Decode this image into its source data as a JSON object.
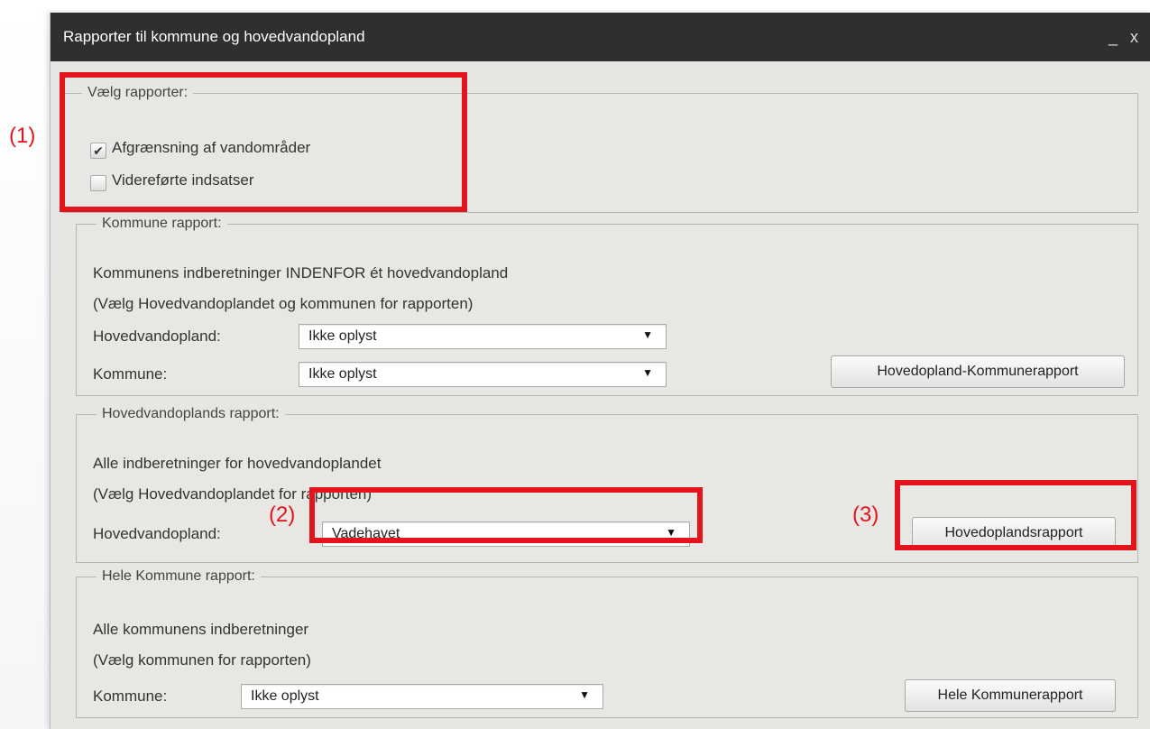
{
  "window": {
    "title": "Rapporter til kommune og hovedvandopland",
    "minimize_label": "_",
    "close_label": "x"
  },
  "top_partial_text": "Rapporter til kommune og hovedvandopland — øverst afskåret",
  "select_reports": {
    "legend": "Vælg rapporter:",
    "options": [
      {
        "label": "Afgrænsning af vandområder",
        "checked": true
      },
      {
        "label": "Videreførte indsatser",
        "checked": false
      }
    ]
  },
  "municipality_report": {
    "legend": "Kommune rapport:",
    "description": "Kommunens indberetninger INDENFOR ét hovedvandopland",
    "hint": "(Vælg Hovedvandoplandet og kommunen for rapporten)",
    "catchment_label": "Hovedvandopland:",
    "catchment_value": "Ikke oplyst",
    "municipality_label": "Kommune:",
    "municipality_value": "Ikke oplyst",
    "button": "Hovedopland-Kommunerapport"
  },
  "catchment_report": {
    "legend": "Hovedvandoplands rapport:",
    "description": "Alle indberetninger for hovedvandoplandet",
    "hint": "(Vælg Hovedvandoplandet for rapporten)",
    "catchment_label": "Hovedvandopland:",
    "catchment_value": "Vadehavet",
    "button": "Hovedoplandsrapport"
  },
  "full_municipality_report": {
    "legend": "Hele Kommune rapport:",
    "description": "Alle kommunens indberetninger",
    "hint": "(Vælg kommunen for rapporten)",
    "municipality_label": "Kommune:",
    "municipality_value": "Ikke oplyst",
    "button": "Hele Kommunerapport"
  },
  "annotations": {
    "one": "(1)",
    "two": "(2)",
    "three": "(3)",
    "color": "#e3141c"
  },
  "icons": {
    "dropdown": "▼",
    "check": "✔"
  }
}
